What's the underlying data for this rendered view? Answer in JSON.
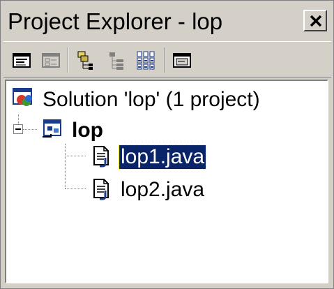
{
  "window": {
    "title": "Project Explorer - lop",
    "close_label": "×"
  },
  "toolbar": {
    "buttons": [
      {
        "name": "view-code-button",
        "icon": "view-code-icon"
      },
      {
        "name": "view-designer-button",
        "icon": "view-designer-icon"
      },
      {
        "name": "toggle-folders-button",
        "icon": "toggle-folders-icon"
      },
      {
        "name": "class-view-button",
        "icon": "class-view-icon"
      },
      {
        "name": "show-all-files-button",
        "icon": "show-all-files-icon"
      },
      {
        "name": "properties-button",
        "icon": "properties-icon"
      }
    ]
  },
  "tree": {
    "solution": {
      "label": "Solution 'lop' (1 project)",
      "icon": "solution-icon"
    },
    "project": {
      "label": "lop",
      "icon": "java-project-icon",
      "expanded": true
    },
    "files": [
      {
        "label": "lop1.java",
        "icon": "java-file-icon",
        "selected": true
      },
      {
        "label": "lop2.java",
        "icon": "java-file-icon",
        "selected": false
      }
    ]
  },
  "colors": {
    "chrome": "#d4d0c8",
    "selection": "#0a246a",
    "tree_background": "#ffffff"
  }
}
